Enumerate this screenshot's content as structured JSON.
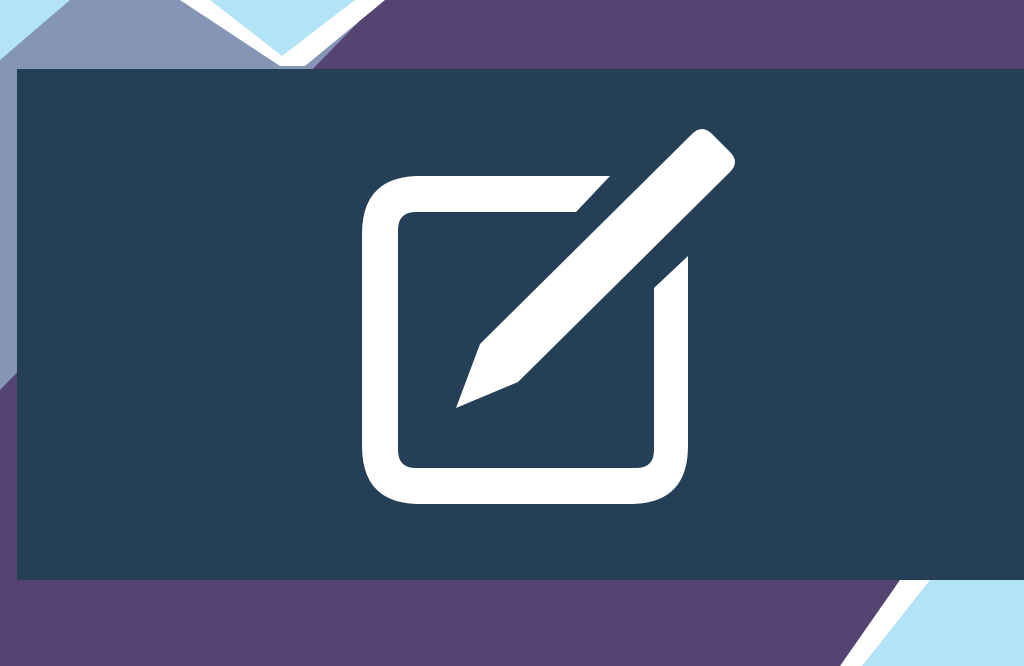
{
  "colors": {
    "background_purple": "#554472",
    "background_slate": "#8495b6",
    "accent_light_blue": "#b3e3f6",
    "stripe_white": "#ffffff",
    "panel_navy": "#253f56",
    "icon_white": "#ffffff"
  },
  "icon": {
    "name": "edit-icon"
  }
}
